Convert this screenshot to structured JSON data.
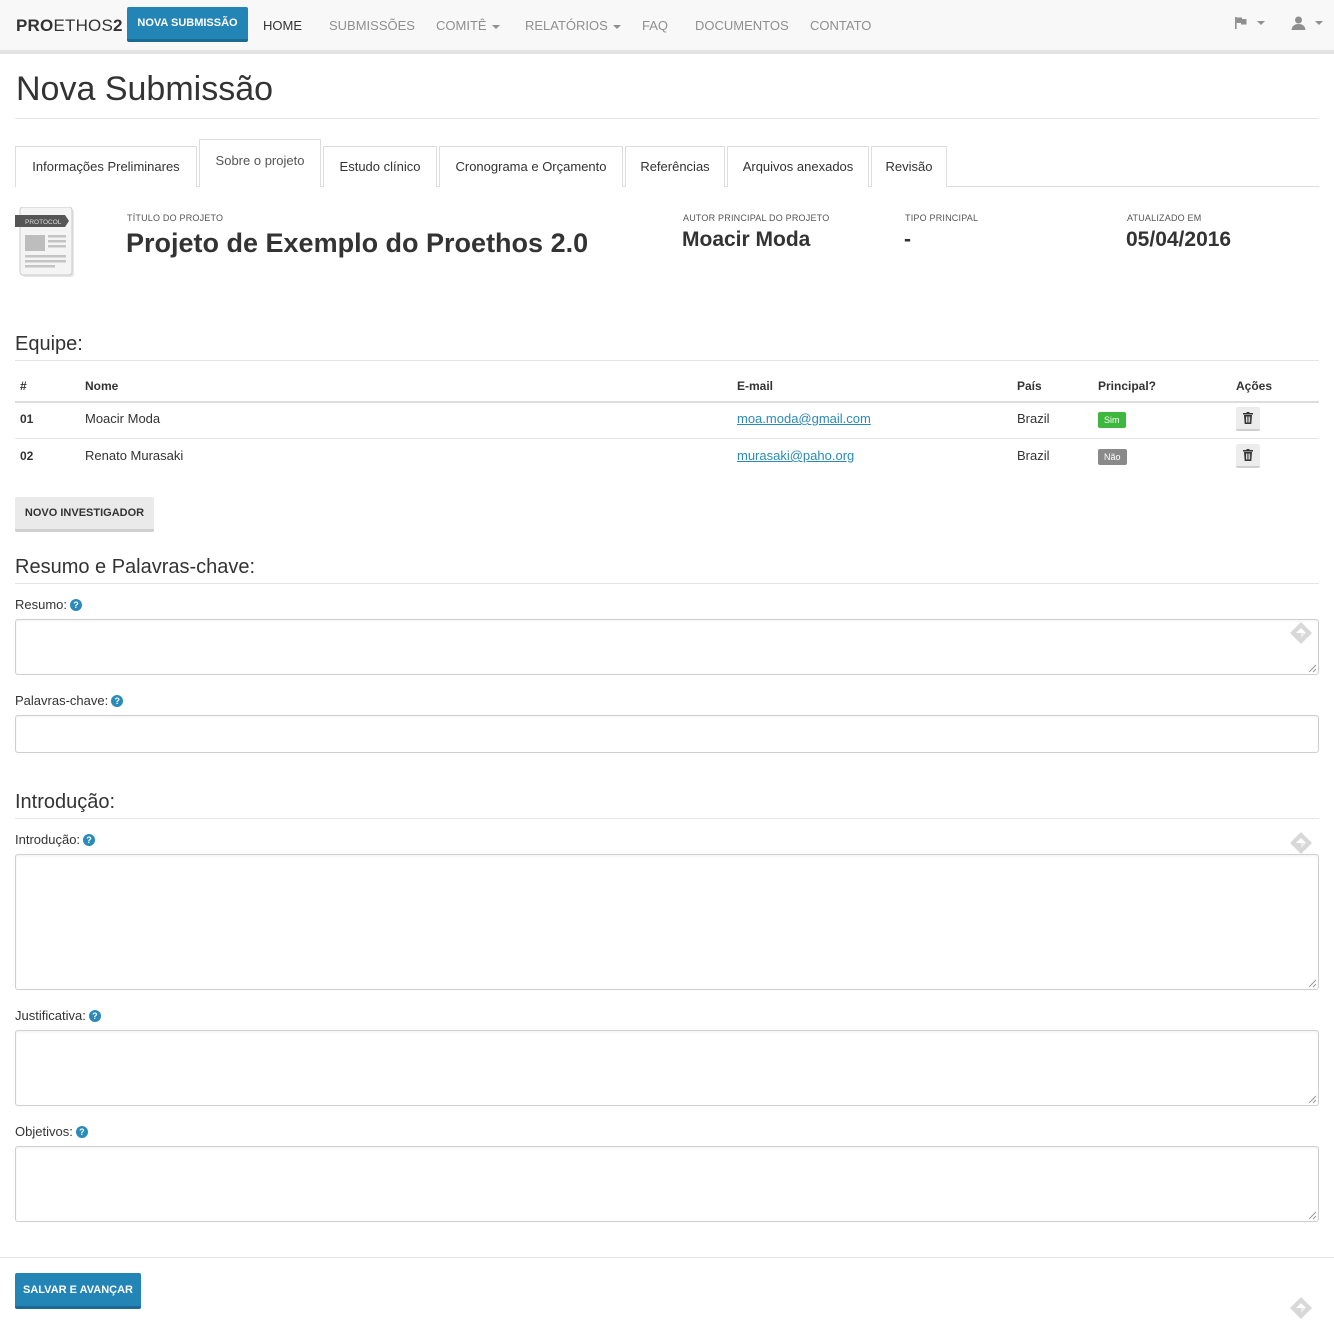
{
  "navbar": {
    "brand_bold": "PRO",
    "brand_light": "ETHOS",
    "brand_suffix": "2",
    "new_submission": "NOVA SUBMISSÃO",
    "links": {
      "home": "HOME",
      "submissions": "SUBMISSÕES",
      "committee": "COMITÊ",
      "reports": "RELATÓRIOS",
      "faq": "FAQ",
      "documents": "DOCUMENTOS",
      "contact": "CONTATO"
    },
    "right_icons": [
      "flag-icon",
      "user-icon"
    ]
  },
  "page": {
    "title": "Nova Submissão"
  },
  "tabs": [
    {
      "label": "Informações Preliminares",
      "active": false
    },
    {
      "label": "Sobre o projeto",
      "active": true
    },
    {
      "label": "Estudo clínico",
      "active": false
    },
    {
      "label": "Cronograma e Orçamento",
      "active": false
    },
    {
      "label": "Referências",
      "active": false
    },
    {
      "label": "Arquivos anexados",
      "active": false
    },
    {
      "label": "Revisão",
      "active": false
    }
  ],
  "project": {
    "icon_text": "PROTOCOL",
    "title_label": "TÍTULO DO PROJETO",
    "title": "Projeto de Exemplo do Proethos 2.0",
    "author_label": "AUTOR PRINCIPAL DO PROJETO",
    "author": "Moacir Moda",
    "type_label": "TIPO PRINCIPAL",
    "type": "-",
    "updated_label": "ATUALIZADO EM",
    "updated": "05/04/2016"
  },
  "team": {
    "heading": "Equipe:",
    "columns": {
      "num": "#",
      "name": "Nome",
      "email": "E-mail",
      "country": "País",
      "principal": "Principal?",
      "actions": "Ações"
    },
    "rows": [
      {
        "num": "01",
        "name": "Moacir Moda",
        "email": "moa.moda@gmail.com",
        "country": "Brazil",
        "principal": "Sim"
      },
      {
        "num": "02",
        "name": "Renato Murasaki",
        "email": "murasaki@paho.org",
        "country": "Brazil",
        "principal": "Não"
      }
    ],
    "add_button": "NOVO INVESTIGADOR"
  },
  "summary": {
    "heading": "Resumo e Palavras-chave:",
    "abstract_label": "Resumo:",
    "abstract_value": "",
    "keywords_label": "Palavras-chave:",
    "keywords_value": ""
  },
  "introduction": {
    "heading": "Introdução:",
    "intro_label": "Introdução:",
    "intro_value": "",
    "justification_label": "Justificativa:",
    "justification_value": "",
    "objectives_label": "Objetivos:",
    "objectives_value": ""
  },
  "help_glyph": "?",
  "footer": {
    "save_button": "SALVAR E AVANÇAR"
  },
  "colors": {
    "primary": "#2384b6",
    "link": "#2a8ab8",
    "badge_yes": "#3db73d",
    "badge_no": "#8a8a8a"
  }
}
